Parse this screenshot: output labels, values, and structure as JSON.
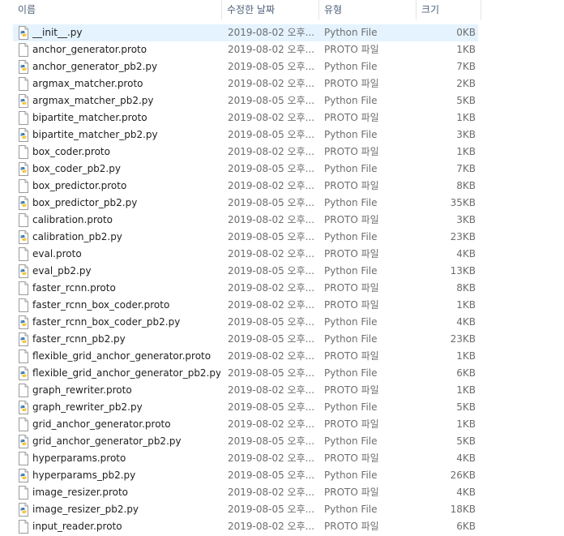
{
  "header": {
    "name": "이름",
    "date": "수정한 날짜",
    "type": "유형",
    "size": "크기"
  },
  "files": [
    {
      "name": "__init__.py",
      "date": "2019-08-02 오후...",
      "type": "Python File",
      "size": "0KB",
      "icon": "python-file-icon",
      "selected": true
    },
    {
      "name": "anchor_generator.proto",
      "date": "2019-08-02 오후...",
      "type": "PROTO 파일",
      "size": "1KB",
      "icon": "blank-file-icon"
    },
    {
      "name": "anchor_generator_pb2.py",
      "date": "2019-08-05 오후...",
      "type": "Python File",
      "size": "7KB",
      "icon": "python-file-icon"
    },
    {
      "name": "argmax_matcher.proto",
      "date": "2019-08-02 오후...",
      "type": "PROTO 파일",
      "size": "2KB",
      "icon": "blank-file-icon"
    },
    {
      "name": "argmax_matcher_pb2.py",
      "date": "2019-08-05 오후...",
      "type": "Python File",
      "size": "5KB",
      "icon": "python-file-icon"
    },
    {
      "name": "bipartite_matcher.proto",
      "date": "2019-08-02 오후...",
      "type": "PROTO 파일",
      "size": "1KB",
      "icon": "blank-file-icon"
    },
    {
      "name": "bipartite_matcher_pb2.py",
      "date": "2019-08-05 오후...",
      "type": "Python File",
      "size": "3KB",
      "icon": "python-file-icon"
    },
    {
      "name": "box_coder.proto",
      "date": "2019-08-02 오후...",
      "type": "PROTO 파일",
      "size": "1KB",
      "icon": "blank-file-icon"
    },
    {
      "name": "box_coder_pb2.py",
      "date": "2019-08-05 오후...",
      "type": "Python File",
      "size": "7KB",
      "icon": "python-file-icon"
    },
    {
      "name": "box_predictor.proto",
      "date": "2019-08-02 오후...",
      "type": "PROTO 파일",
      "size": "8KB",
      "icon": "blank-file-icon"
    },
    {
      "name": "box_predictor_pb2.py",
      "date": "2019-08-05 오후...",
      "type": "Python File",
      "size": "35KB",
      "icon": "python-file-icon"
    },
    {
      "name": "calibration.proto",
      "date": "2019-08-02 오후...",
      "type": "PROTO 파일",
      "size": "3KB",
      "icon": "blank-file-icon"
    },
    {
      "name": "calibration_pb2.py",
      "date": "2019-08-05 오후...",
      "type": "Python File",
      "size": "23KB",
      "icon": "python-file-icon"
    },
    {
      "name": "eval.proto",
      "date": "2019-08-02 오후...",
      "type": "PROTO 파일",
      "size": "4KB",
      "icon": "blank-file-icon"
    },
    {
      "name": "eval_pb2.py",
      "date": "2019-08-05 오후...",
      "type": "Python File",
      "size": "13KB",
      "icon": "python-file-icon"
    },
    {
      "name": "faster_rcnn.proto",
      "date": "2019-08-02 오후...",
      "type": "PROTO 파일",
      "size": "8KB",
      "icon": "blank-file-icon"
    },
    {
      "name": "faster_rcnn_box_coder.proto",
      "date": "2019-08-02 오후...",
      "type": "PROTO 파일",
      "size": "1KB",
      "icon": "blank-file-icon"
    },
    {
      "name": "faster_rcnn_box_coder_pb2.py",
      "date": "2019-08-05 오후...",
      "type": "Python File",
      "size": "4KB",
      "icon": "python-file-icon"
    },
    {
      "name": "faster_rcnn_pb2.py",
      "date": "2019-08-05 오후...",
      "type": "Python File",
      "size": "23KB",
      "icon": "python-file-icon"
    },
    {
      "name": "flexible_grid_anchor_generator.proto",
      "date": "2019-08-02 오후...",
      "type": "PROTO 파일",
      "size": "1KB",
      "icon": "blank-file-icon"
    },
    {
      "name": "flexible_grid_anchor_generator_pb2.py",
      "date": "2019-08-05 오후...",
      "type": "Python File",
      "size": "6KB",
      "icon": "python-file-icon"
    },
    {
      "name": "graph_rewriter.proto",
      "date": "2019-08-02 오후...",
      "type": "PROTO 파일",
      "size": "1KB",
      "icon": "blank-file-icon"
    },
    {
      "name": "graph_rewriter_pb2.py",
      "date": "2019-08-05 오후...",
      "type": "Python File",
      "size": "5KB",
      "icon": "python-file-icon"
    },
    {
      "name": "grid_anchor_generator.proto",
      "date": "2019-08-02 오후...",
      "type": "PROTO 파일",
      "size": "1KB",
      "icon": "blank-file-icon"
    },
    {
      "name": "grid_anchor_generator_pb2.py",
      "date": "2019-08-05 오후...",
      "type": "Python File",
      "size": "5KB",
      "icon": "python-file-icon"
    },
    {
      "name": "hyperparams.proto",
      "date": "2019-08-02 오후...",
      "type": "PROTO 파일",
      "size": "4KB",
      "icon": "blank-file-icon"
    },
    {
      "name": "hyperparams_pb2.py",
      "date": "2019-08-05 오후...",
      "type": "Python File",
      "size": "26KB",
      "icon": "python-file-icon"
    },
    {
      "name": "image_resizer.proto",
      "date": "2019-08-02 오후...",
      "type": "PROTO 파일",
      "size": "4KB",
      "icon": "blank-file-icon"
    },
    {
      "name": "image_resizer_pb2.py",
      "date": "2019-08-05 오후...",
      "type": "Python File",
      "size": "18KB",
      "icon": "python-file-icon"
    },
    {
      "name": "input_reader.proto",
      "date": "2019-08-02 오후...",
      "type": "PROTO 파일",
      "size": "6KB",
      "icon": "blank-file-icon"
    }
  ],
  "colors": {
    "selected_row": "#e5f3ff",
    "header_text": "#4c607a",
    "secondary_text": "#6d6d6d"
  }
}
